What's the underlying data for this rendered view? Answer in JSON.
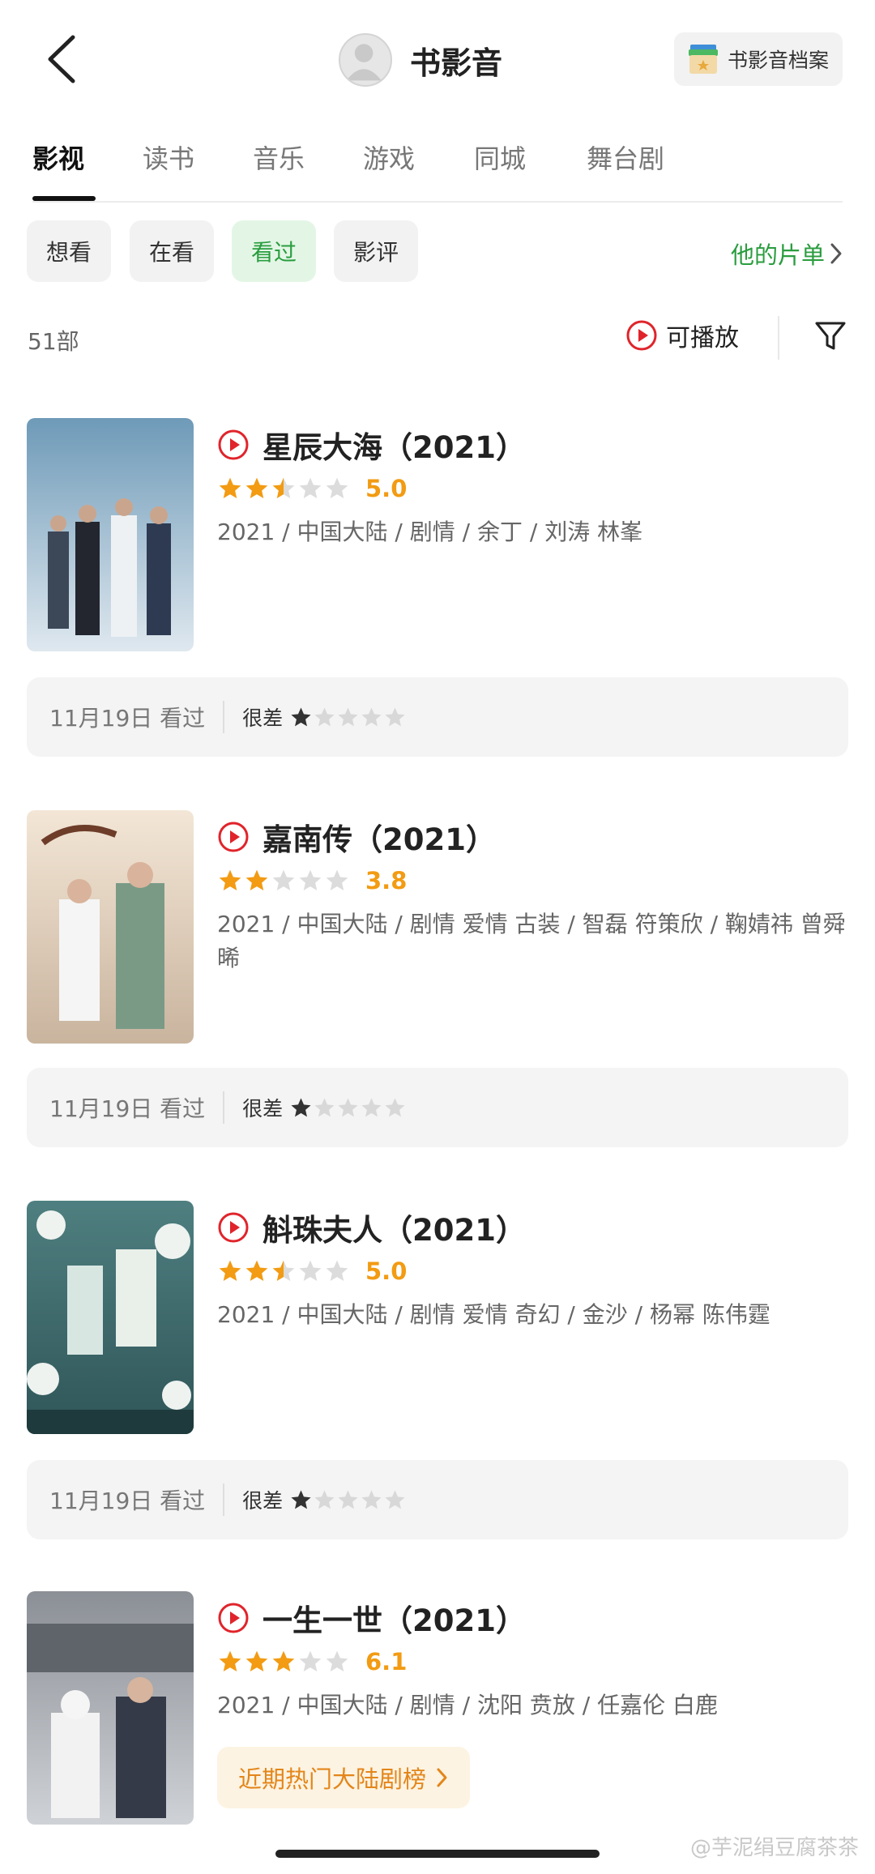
{
  "header": {
    "title": "书影音",
    "archive_label": "书影音档案"
  },
  "tabs": [
    "影视",
    "读书",
    "音乐",
    "游戏",
    "同城",
    "舞台剧"
  ],
  "filters": [
    "想看",
    "在看",
    "看过",
    "影评"
  ],
  "active_filter": "看过",
  "his_list_label": "他的片单",
  "count_label": "51部",
  "playable_label": "可播放",
  "colors": {
    "accent_green": "#2a9d3f",
    "score_orange": "#f29b13",
    "play_red": "#e0242b"
  },
  "items": [
    {
      "title": "星辰大海（2021）",
      "stars": 2.5,
      "score": "5.0",
      "meta": "2021 / 中国大陆 / 剧情 / 余丁 / 刘涛 林峯",
      "review": {
        "date": "11月19日 看过",
        "label": "很差",
        "stars": 1
      }
    },
    {
      "title": "嘉南传（2021）",
      "stars": 2,
      "score": "3.8",
      "meta": "2021 / 中国大陆 / 剧情 爱情 古装 / 智磊 符策欣 / 鞠婧祎 曾舜晞",
      "review": {
        "date": "11月19日 看过",
        "label": "很差",
        "stars": 1
      }
    },
    {
      "title": "斛珠夫人（2021）",
      "stars": 2.5,
      "score": "5.0",
      "meta": "2021 / 中国大陆 / 剧情 爱情 奇幻 / 金沙 / 杨幂 陈伟霆",
      "review": {
        "date": "11月19日 看过",
        "label": "很差",
        "stars": 1
      }
    },
    {
      "title": "一生一世（2021）",
      "stars": 3,
      "score": "6.1",
      "meta": "2021 / 中国大陆 / 剧情 / 沈阳 贲放 / 任嘉伦 白鹿",
      "hot_label": "近期热门大陆剧榜"
    }
  ],
  "watermark": "@芋泥绢豆腐茶茶"
}
